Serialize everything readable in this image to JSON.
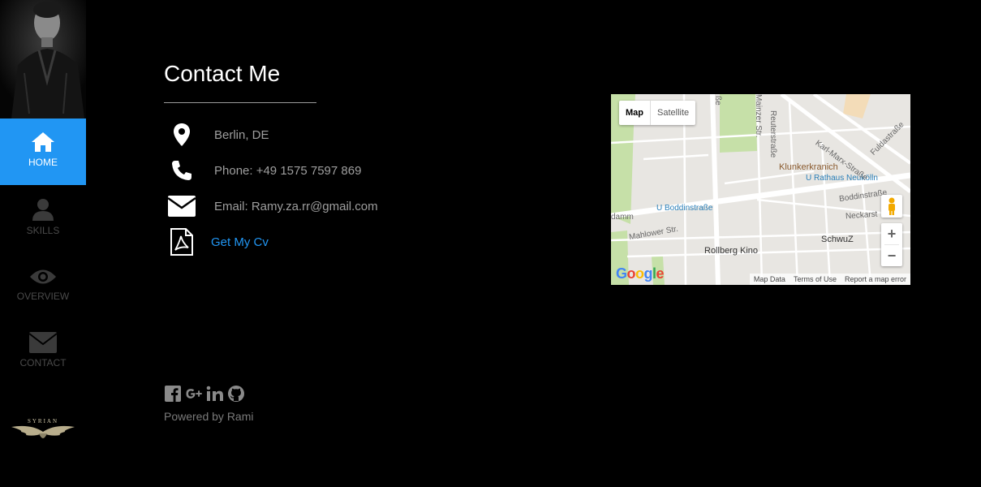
{
  "sidebar": {
    "items": [
      {
        "label": "HOME",
        "icon": "home-icon",
        "active": true
      },
      {
        "label": "SKILLS",
        "icon": "user-icon",
        "active": false
      },
      {
        "label": "OVERVIEW",
        "icon": "eye-icon",
        "active": false
      },
      {
        "label": "CONTACT",
        "icon": "envelope-icon",
        "active": false
      }
    ],
    "logo_text": "SYRIAN"
  },
  "main": {
    "title": "Contact Me",
    "contacts": [
      {
        "icon": "map-marker-icon",
        "text": "Berlin, DE"
      },
      {
        "icon": "phone-icon",
        "text": "Phone: +49 1575 7597 869"
      },
      {
        "icon": "envelope-icon",
        "text": "Email: Ramy.za.rr@gmail.com"
      },
      {
        "icon": "pdf-file-icon",
        "text": "Get My Cv"
      }
    ]
  },
  "map": {
    "tabs": [
      "Map",
      "Satellite"
    ],
    "selected_tab": "Map",
    "labels": {
      "klunkerkranich": "Klunkerkranich",
      "rathaus": "U Rathaus Neukölln",
      "boddinstrasse_station": "U Boddinstraße",
      "boddinstrasse": "Boddinstraße",
      "neckarstr": "Neckarst",
      "mahlower": "Mahlower Str.",
      "rollberg": "Rollberg Kino",
      "schwuz": "SchwuZ",
      "karl_marx": "Karl-Marx-Straße",
      "fuldastrasse": "Fuldastraße",
      "reuterstrasse": "Reuterstraße",
      "mainzer": "Mainzer Str.",
      "damm": "damm",
      "sse": "ße"
    },
    "footer": [
      "Map Data",
      "Terms of Use",
      "Report a map error"
    ],
    "logo": "Google"
  },
  "footer": {
    "social": [
      "facebook-icon",
      "google-plus-icon",
      "linkedin-icon",
      "github-icon"
    ],
    "powered": "Powered by Rami"
  },
  "colors": {
    "accent": "#2196f3",
    "background": "#000000",
    "muted_text": "#9e9e9e",
    "inactive_nav": "#4a4a4a"
  }
}
